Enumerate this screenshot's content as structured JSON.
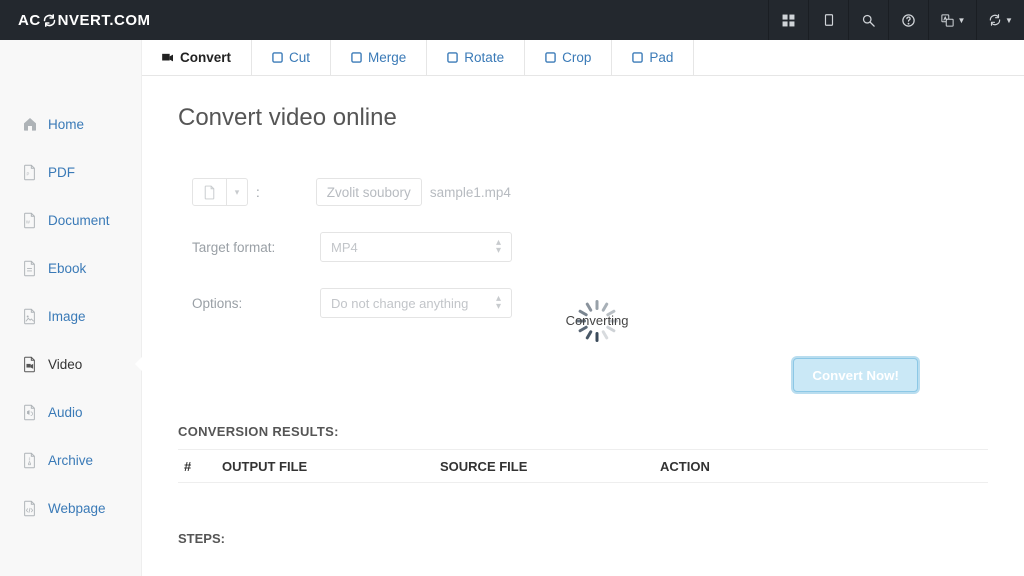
{
  "brand": {
    "left": "AC",
    "right": "NVERT.COM"
  },
  "sidebar": {
    "items": [
      {
        "label": "Home"
      },
      {
        "label": "PDF"
      },
      {
        "label": "Document"
      },
      {
        "label": "Ebook"
      },
      {
        "label": "Image"
      },
      {
        "label": "Video"
      },
      {
        "label": "Audio"
      },
      {
        "label": "Archive"
      },
      {
        "label": "Webpage"
      }
    ]
  },
  "tabs": [
    {
      "label": "Convert"
    },
    {
      "label": "Cut"
    },
    {
      "label": "Merge"
    },
    {
      "label": "Rotate"
    },
    {
      "label": "Crop"
    },
    {
      "label": "Pad"
    }
  ],
  "page": {
    "title": "Convert video online",
    "colon": ":",
    "choose_label": "Zvolit soubory",
    "file_name": "sample1.mp4",
    "target_format_label": "Target format:",
    "target_format_value": "MP4",
    "options_label": "Options:",
    "options_value": "Do not change anything",
    "convert_button": "Convert Now!",
    "loading_text": "Converting",
    "results_heading": "CONVERSION RESULTS:",
    "columns": {
      "hash": "#",
      "output": "OUTPUT FILE",
      "source": "SOURCE FILE",
      "action": "ACTION"
    },
    "steps_heading": "STEPS:"
  }
}
